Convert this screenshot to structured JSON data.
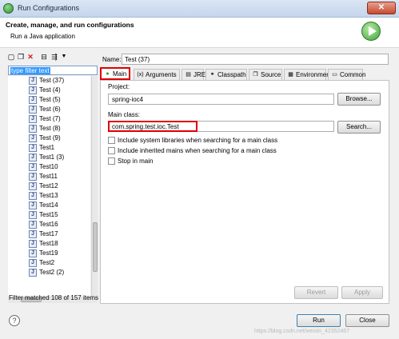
{
  "window": {
    "title": "Run Configurations",
    "close_glyph": "✕"
  },
  "header": {
    "title": "Create, manage, and run configurations",
    "subtitle": "Run a Java application",
    "icon": "run-icon"
  },
  "left": {
    "toolbar_icons": [
      "new-launch-config-icon",
      "duplicate-icon",
      "delete-icon",
      "collapse-all-icon",
      "filter-icon",
      "view-menu-icon"
    ],
    "filter_text": "type filter text",
    "items": [
      "Test (37)",
      "Test (4)",
      "Test (5)",
      "Test (6)",
      "Test (7)",
      "Test (8)",
      "Test (9)",
      "Test1",
      "Test1 (3)",
      "Test10",
      "Test11",
      "Test12",
      "Test13",
      "Test14",
      "Test15",
      "Test16",
      "Test17",
      "Test18",
      "Test19",
      "Test2",
      "Test2 (2)"
    ],
    "status": "Filter matched 108 of 157 items"
  },
  "right": {
    "name_label": "Name:",
    "name_value": "Test (37)",
    "tabs": [
      {
        "label": "Main",
        "icon": "main-tab-icon",
        "active": true
      },
      {
        "label": "Arguments",
        "icon": "arguments-icon"
      },
      {
        "label": "JRE",
        "icon": "jre-icon"
      },
      {
        "label": "Classpath",
        "icon": "classpath-icon"
      },
      {
        "label": "Source",
        "icon": "source-icon"
      },
      {
        "label": "Environment",
        "icon": "environment-icon"
      },
      {
        "label": "Common",
        "icon": "common-icon"
      }
    ],
    "project_label": "Project:",
    "project_value": "spring-ioc4",
    "browse_label": "Browse...",
    "main_class_label": "Main class:",
    "main_class_value": "com.spring.test.ioc.Test",
    "search_label": "Search...",
    "checkboxes": [
      {
        "label": "Include system libraries when searching for a main class",
        "checked": false
      },
      {
        "label": "Include inherited mains when searching for a main class",
        "checked": false
      },
      {
        "label": "Stop in main",
        "checked": false
      }
    ],
    "revert_label": "Revert",
    "apply_label": "Apply"
  },
  "footer": {
    "run_label": "Run",
    "close_label": "Close",
    "help_glyph": "?"
  },
  "watermark": "https://blog.csdn.net/weixin_42352467",
  "colors": {
    "highlight": "#e00000",
    "selection": "#3399ff"
  }
}
